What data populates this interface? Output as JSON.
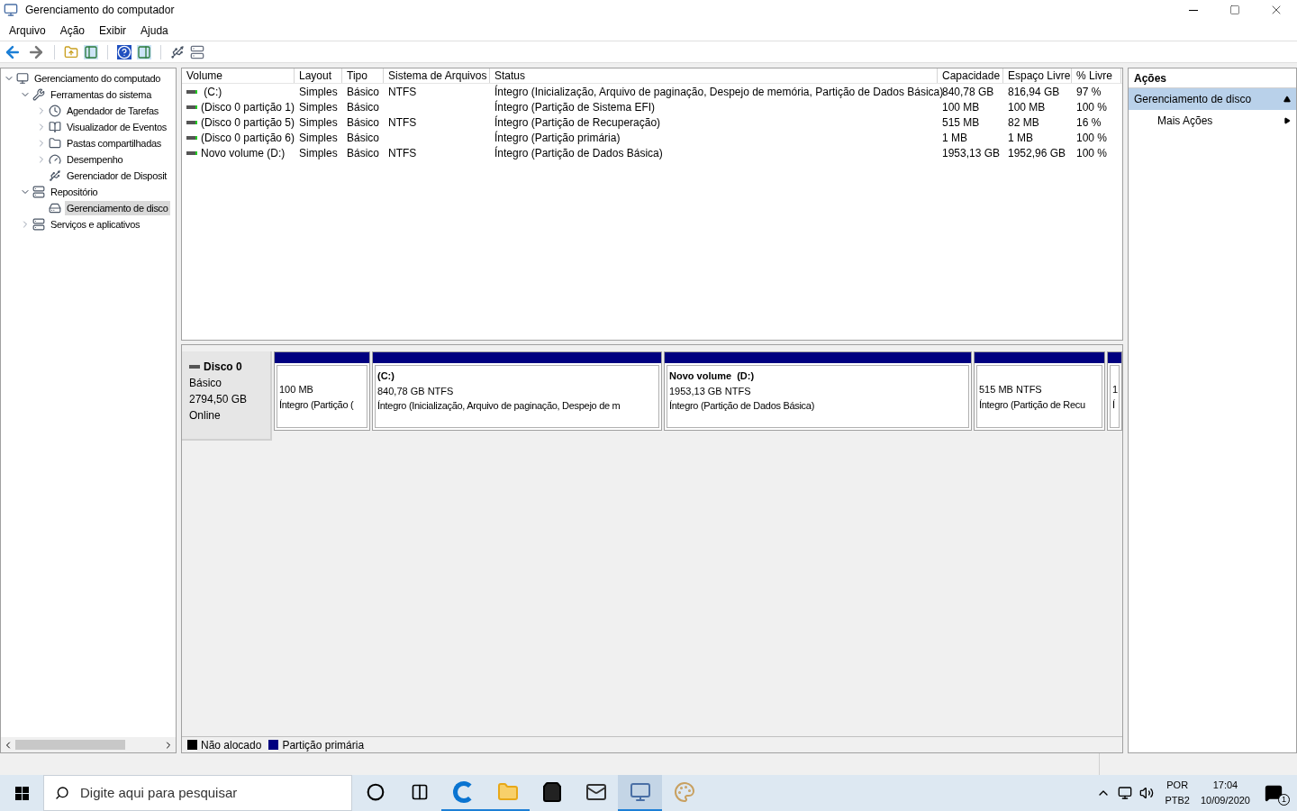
{
  "window": {
    "title": "Gerenciamento do computador"
  },
  "menu": [
    "Arquivo",
    "Ação",
    "Exibir",
    "Ajuda"
  ],
  "tree": [
    {
      "label": "Gerenciamento do computado",
      "selected": false,
      "expanded": true,
      "children": [
        {
          "label": "Ferramentas do sistema",
          "selected": false,
          "expanded": true,
          "children": [
            {
              "label": "Agendador de Tarefas",
              "selected": false,
              "expanded": false
            },
            {
              "label": "Visualizador de Eventos",
              "selected": false,
              "expanded": false
            },
            {
              "label": "Pastas compartilhadas",
              "selected": false,
              "expanded": false
            },
            {
              "label": "Desempenho",
              "selected": false,
              "expanded": false
            },
            {
              "label": "Gerenciador de Disposit",
              "selected": false
            }
          ]
        },
        {
          "label": "Repositório",
          "selected": false,
          "expanded": true,
          "children": [
            {
              "label": "Gerenciamento de disco",
              "selected": true
            }
          ]
        },
        {
          "label": "Serviços e aplicativos",
          "selected": false,
          "expanded": false
        }
      ]
    }
  ],
  "table": {
    "columns": [
      "Volume",
      "Layout",
      "Tipo",
      "Sistema de Arquivos",
      "Status",
      "Capacidade",
      "Espaço Livre",
      "% Livre"
    ],
    "rows": [
      [
        " (C:)",
        "Simples",
        "Básico",
        "NTFS",
        "Íntegro (Inicialização, Arquivo de paginação, Despejo de memória, Partição de Dados Básica)",
        "840,78 GB",
        "816,94 GB",
        "97 %"
      ],
      [
        "(Disco 0 partição 1)",
        "Simples",
        "Básico",
        "",
        "Íntegro (Partição de Sistema EFI)",
        "100 MB",
        "100 MB",
        "100 %"
      ],
      [
        "(Disco 0 partição 5)",
        "Simples",
        "Básico",
        "NTFS",
        "Íntegro (Partição de Recuperação)",
        "515 MB",
        "82 MB",
        "16 %"
      ],
      [
        "(Disco 0 partição 6)",
        "Simples",
        "Básico",
        "",
        "Íntegro (Partição primária)",
        "1 MB",
        "1 MB",
        "100 %"
      ],
      [
        "Novo volume (D:)",
        "Simples",
        "Básico",
        "NTFS",
        "Íntegro (Partição de Dados Básica)",
        "1953,13 GB",
        "1952,96 GB",
        "100 %"
      ]
    ]
  },
  "disk": {
    "name": "Disco 0",
    "type": "Básico",
    "size": "2794,50 GB",
    "state": "Online",
    "partitions": [
      {
        "size": "100 MB",
        "status": "Íntegro (Partição (",
        "color": "#000080"
      },
      {
        "name": "(C:)",
        "size": "840,78 GB NTFS",
        "status": "Íntegro (Inicialização, Arquivo de paginação, Despejo de m",
        "color": "#000080"
      },
      {
        "name": "Novo volume  (D:)",
        "size": "1953,13 GB NTFS",
        "status": "Íntegro (Partição de Dados Básica)",
        "color": "#000080"
      },
      {
        "size": "515 MB NTFS",
        "status": "Íntegro (Partição de Recu",
        "color": "#000080"
      },
      {
        "size": "1",
        "status": "Í",
        "color": "#000080"
      }
    ]
  },
  "legend": [
    {
      "label": "Não alocado",
      "color": "#000000"
    },
    {
      "label": "Partição primária",
      "color": "#000080"
    }
  ],
  "actions": {
    "title": "Ações",
    "section": "Gerenciamento de disco",
    "expanded": true,
    "items": [
      "Mais Ações"
    ]
  },
  "taskbar": {
    "search_placeholder": "Digite aqui para pesquisar",
    "apps": [
      {
        "kind": "cortana",
        "active": false
      },
      {
        "kind": "taskview",
        "active": false
      },
      {
        "kind": "edge",
        "active": true
      },
      {
        "kind": "explorer",
        "active": true
      },
      {
        "kind": "store",
        "active": false
      },
      {
        "kind": "mail",
        "active": false
      },
      {
        "kind": "compmgmt",
        "active": true,
        "selected": true
      },
      {
        "kind": "paint",
        "active": false,
        "selected": false
      }
    ],
    "lang": "POR",
    "layout": "PTB2",
    "time": "17:04",
    "date": "10/09/2020",
    "notifications": "1"
  }
}
